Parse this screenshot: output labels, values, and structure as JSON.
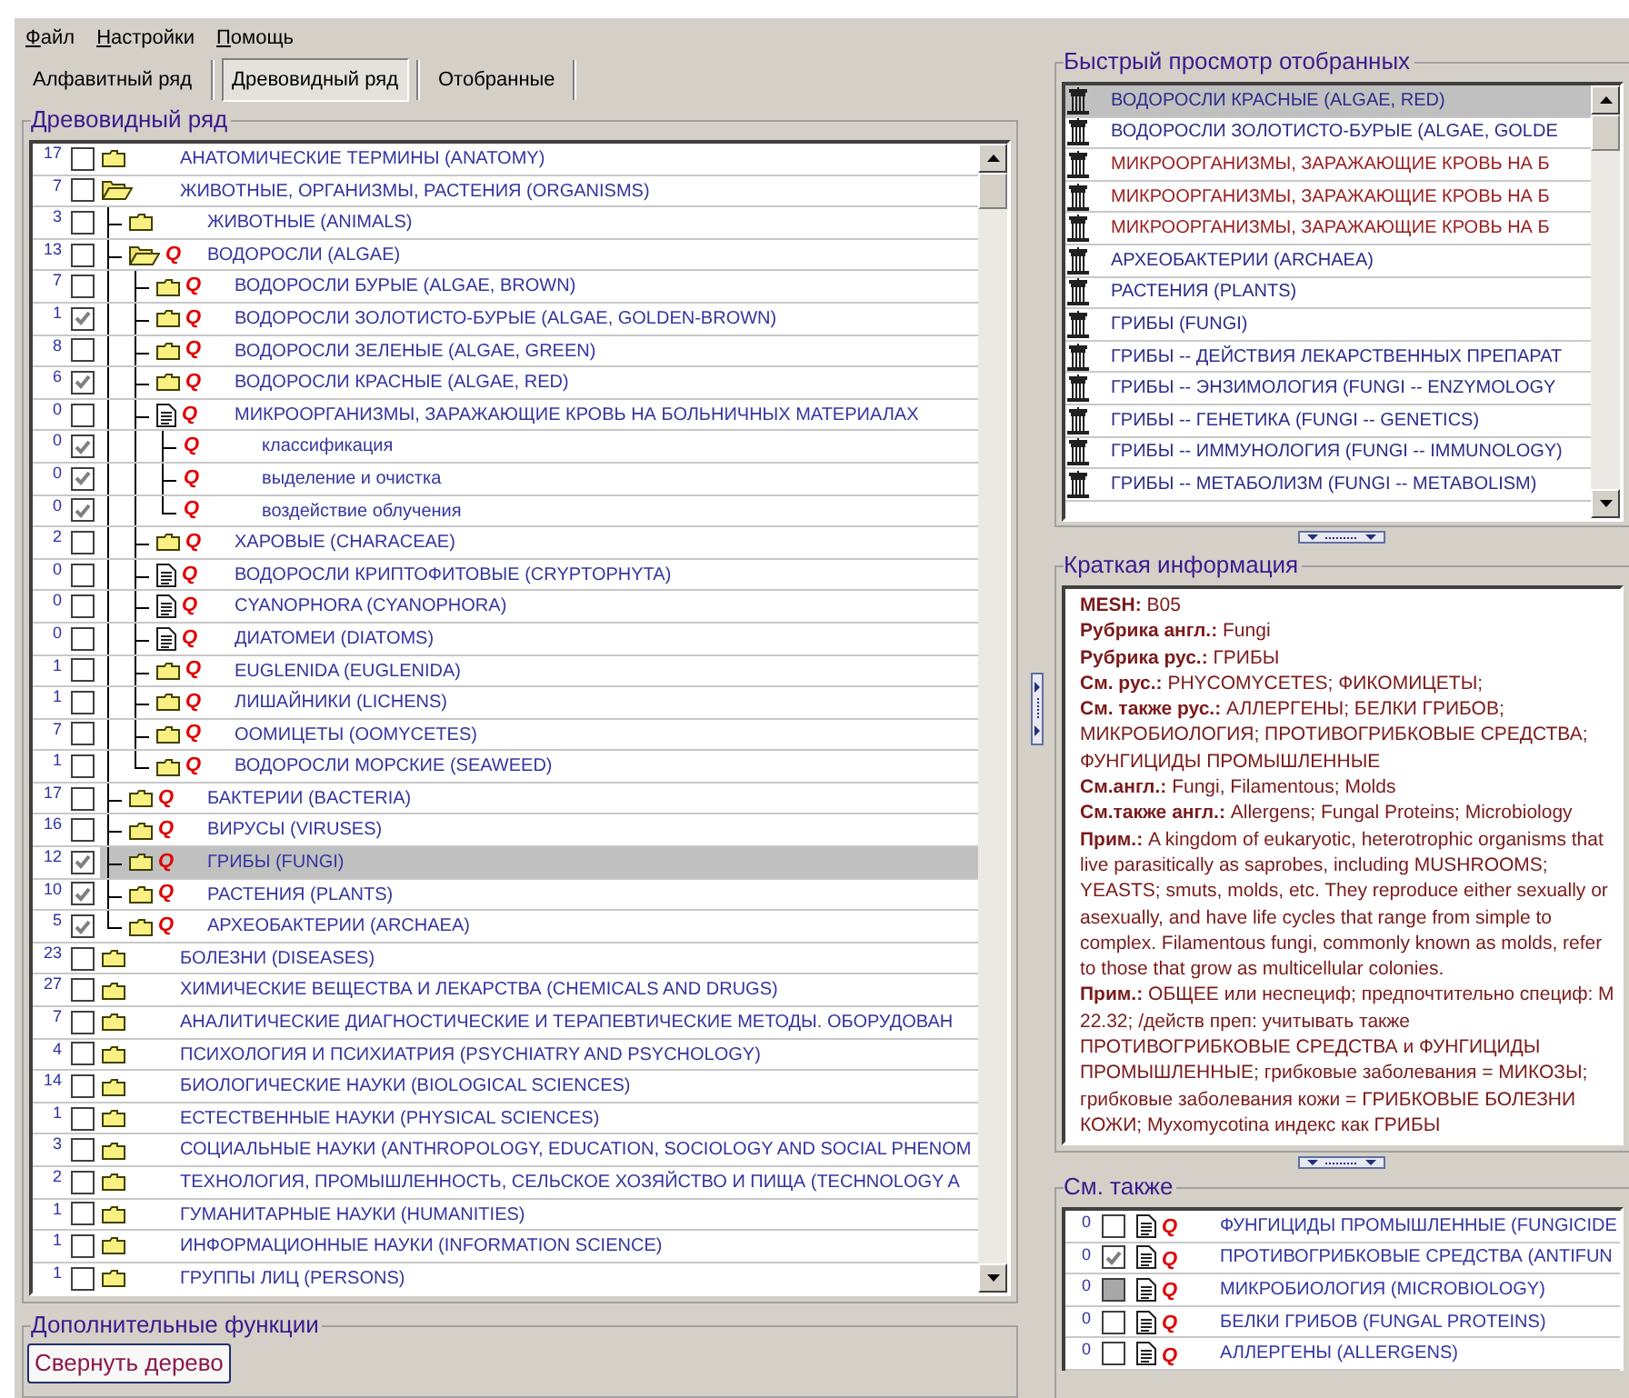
{
  "menu": [
    "Файл",
    "Настройки",
    "Помощь"
  ],
  "tabs": [
    {
      "label": "Алфавитный ряд",
      "selected": false
    },
    {
      "label": "Древовидный ряд",
      "selected": true
    },
    {
      "label": "Отобранные",
      "selected": false
    }
  ],
  "tree": {
    "title": "Древовидный ряд",
    "rows": [
      {
        "count": "17",
        "checked": false,
        "selected": false,
        "kind": "folder",
        "label": "АНАТОМИЧЕСКИЕ ТЕРМИНЫ (ANATOMY)"
      },
      {
        "count": "7",
        "checked": false,
        "selected": false,
        "kind": "open",
        "label": "ЖИВОТНЫЕ, ОРГАНИЗМЫ, РАСТЕНИЯ (ORGANISMS)",
        "children": [
          {
            "count": "3",
            "checked": false,
            "selected": false,
            "kind": "folder",
            "label": "ЖИВОТНЫЕ (ANIMALS)"
          },
          {
            "count": "13",
            "checked": false,
            "selected": false,
            "kind": "open",
            "mark": "Q",
            "label": "ВОДОРОСЛИ (ALGAE)",
            "children": [
              {
                "count": "7",
                "checked": false,
                "selected": false,
                "kind": "folder",
                "mark": "Q",
                "label": "ВОДОРОСЛИ БУРЫЕ (ALGAE, BROWN)"
              },
              {
                "count": "1",
                "checked": true,
                "selected": false,
                "kind": "folder",
                "mark": "Q",
                "label": "ВОДОРОСЛИ ЗОЛОТИСТО-БУРЫЕ (ALGAE, GOLDEN-BROWN)"
              },
              {
                "count": "8",
                "checked": false,
                "selected": false,
                "kind": "folder",
                "mark": "Q",
                "label": "ВОДОРОСЛИ ЗЕЛЕНЫЕ (ALGAE, GREEN)"
              },
              {
                "count": "6",
                "checked": true,
                "selected": false,
                "kind": "folder",
                "mark": "Q",
                "label": "ВОДОРОСЛИ КРАСНЫЕ (ALGAE, RED)"
              },
              {
                "count": "0",
                "checked": false,
                "selected": false,
                "kind": "document",
                "mark": "Q",
                "label": "МИКРООРГАНИЗМЫ, ЗАРАЖАЮЩИЕ КРОВЬ НА БОЛЬНИЧНЫХ МАТЕРИАЛАХ",
                "children": [
                  {
                    "count": "0",
                    "checked": true,
                    "selected": false,
                    "mark": "Q",
                    "label": "классификация"
                  },
                  {
                    "count": "0",
                    "checked": true,
                    "selected": false,
                    "mark": "Q",
                    "label": "выделение и очистка"
                  },
                  {
                    "count": "0",
                    "checked": true,
                    "selected": false,
                    "mark": "Q",
                    "label": "воздействие облучения"
                  }
                ]
              },
              {
                "count": "2",
                "checked": false,
                "selected": false,
                "kind": "folder",
                "mark": "Q",
                "label": "ХАРОВЫЕ (CHARACEAE)"
              },
              {
                "count": "0",
                "checked": false,
                "selected": false,
                "kind": "document",
                "mark": "Q",
                "label": "ВОДОРОСЛИ КРИПТОФИТОВЫЕ (CRYPTOPHYTA)"
              },
              {
                "count": "0",
                "checked": false,
                "selected": false,
                "kind": "document",
                "mark": "Q",
                "label": "CYANOPHORA (CYANOPHORA)"
              },
              {
                "count": "0",
                "checked": false,
                "selected": false,
                "kind": "document",
                "mark": "Q",
                "label": "ДИАТОМЕИ (DIATOMS)"
              },
              {
                "count": "1",
                "checked": false,
                "selected": false,
                "kind": "folder",
                "mark": "Q",
                "label": "EUGLENIDA (EUGLENIDA)"
              },
              {
                "count": "1",
                "checked": false,
                "selected": false,
                "kind": "folder",
                "mark": "Q",
                "label": "ЛИШАЙНИКИ (LICHENS)"
              },
              {
                "count": "7",
                "checked": false,
                "selected": false,
                "kind": "folder",
                "mark": "Q",
                "label": "ООМИЦЕТЫ (OOMYCETES)"
              },
              {
                "count": "1",
                "checked": false,
                "selected": false,
                "kind": "folder",
                "mark": "Q",
                "label": "ВОДОРОСЛИ МОРСКИЕ (SEAWEED)"
              }
            ]
          },
          {
            "count": "17",
            "checked": false,
            "selected": false,
            "kind": "folder",
            "mark": "Q",
            "label": "БАКТЕРИИ (BACTERIA)"
          },
          {
            "count": "16",
            "checked": false,
            "selected": false,
            "kind": "folder",
            "mark": "Q",
            "label": "ВИРУСЫ (VIRUSES)"
          },
          {
            "count": "12",
            "checked": true,
            "selected": true,
            "kind": "folder",
            "mark": "Q",
            "label": "ГРИБЫ (FUNGI)"
          },
          {
            "count": "10",
            "checked": true,
            "selected": false,
            "kind": "folder",
            "mark": "Q",
            "label": "РАСТЕНИЯ (PLANTS)"
          },
          {
            "count": "5",
            "checked": true,
            "selected": false,
            "kind": "folder",
            "mark": "Q",
            "label": "АРХЕОБАКТЕРИИ (ARCHAEA)"
          }
        ]
      },
      {
        "count": "23",
        "checked": false,
        "selected": false,
        "kind": "folder",
        "label": "БОЛЕЗНИ (DISEASES)"
      },
      {
        "count": "27",
        "checked": false,
        "selected": false,
        "kind": "folder",
        "label": "ХИМИЧЕСКИЕ ВЕЩЕСТВА И ЛЕКАРСТВА (CHEMICALS AND DRUGS)"
      },
      {
        "count": "7",
        "checked": false,
        "selected": false,
        "kind": "folder",
        "label": "АНАЛИТИЧЕСКИЕ ДИАГНОСТИЧЕСКИЕ И ТЕРАПЕВТИЧЕСКИЕ МЕТОДЫ. ОБОРУДОВАН"
      },
      {
        "count": "4",
        "checked": false,
        "selected": false,
        "kind": "folder",
        "label": "ПСИХОЛОГИЯ И ПСИХИАТРИЯ (PSYCHIATRY AND PSYCHOLOGY)"
      },
      {
        "count": "14",
        "checked": false,
        "selected": false,
        "kind": "folder",
        "label": "БИОЛОГИЧЕСКИЕ НАУКИ (BIOLOGICAL SCIENCES)"
      },
      {
        "count": "1",
        "checked": false,
        "selected": false,
        "kind": "folder",
        "label": "ЕСТЕСТВЕННЫЕ НАУКИ (PHYSICAL SCIENCES)"
      },
      {
        "count": "3",
        "checked": false,
        "selected": false,
        "kind": "folder",
        "label": "СОЦИАЛЬНЫЕ НАУКИ (ANTHROPOLOGY, EDUCATION, SOCIOLOGY AND SOCIAL PHENOM"
      },
      {
        "count": "2",
        "checked": false,
        "selected": false,
        "kind": "folder",
        "label": "ТЕХНОЛОГИЯ, ПРОМЫШЛЕННОСТЬ, СЕЛЬСКОЕ ХОЗЯЙСТВО И ПИЩА (TECHNOLOGY A"
      },
      {
        "count": "1",
        "checked": false,
        "selected": false,
        "kind": "folder",
        "label": "ГУМАНИТАРНЫЕ НАУКИ (HUMANITIES)"
      },
      {
        "count": "1",
        "checked": false,
        "selected": false,
        "kind": "folder",
        "label": "ИНФОРМАЦИОННЫЕ НАУКИ (INFORMATION SCIENCE)"
      },
      {
        "count": "1",
        "checked": false,
        "selected": false,
        "kind": "folder",
        "label": "ГРУППЫ ЛИЦ (PERSONS)"
      }
    ]
  },
  "extra": {
    "title": "Дополнительные функции",
    "button": "Свернуть дерево"
  },
  "quick_view": {
    "title": "Быстрый просмотр отобранных",
    "items": [
      {
        "label": "ВОДОРОСЛИ КРАСНЫЕ (ALGAE, RED)",
        "color": "#2c2c8c",
        "selected": true
      },
      {
        "label": "ВОДОРОСЛИ ЗОЛОТИСТО-БУРЫЕ (ALGAE, GOLDE",
        "color": "#2c2c8c",
        "selected": false
      },
      {
        "label": "МИКРООРГАНИЗМЫ, ЗАРАЖАЮЩИЕ КРОВЬ НА Б",
        "color": "#9a2020",
        "selected": false
      },
      {
        "label": "МИКРООРГАНИЗМЫ, ЗАРАЖАЮЩИЕ КРОВЬ НА Б",
        "color": "#9a2020",
        "selected": false
      },
      {
        "label": "МИКРООРГАНИЗМЫ, ЗАРАЖАЮЩИЕ КРОВЬ НА Б",
        "color": "#9a2020",
        "selected": false
      },
      {
        "label": "АРХЕОБАКТЕРИИ (ARCHAEA)",
        "color": "#2c2c8c",
        "selected": false
      },
      {
        "label": "РАСТЕНИЯ (PLANTS)",
        "color": "#2c2c8c",
        "selected": false
      },
      {
        "label": "ГРИБЫ (FUNGI)",
        "color": "#2c2c8c",
        "selected": false
      },
      {
        "label": "ГРИБЫ -- ДЕЙСТВИЯ ЛЕКАРСТВЕННЫХ ПРЕПАРАТ",
        "color": "#2c2c8c",
        "selected": false
      },
      {
        "label": "ГРИБЫ -- ЭНЗИМОЛОГИЯ (FUNGI -- ENZYMOLOGY",
        "color": "#2c2c8c",
        "selected": false
      },
      {
        "label": "ГРИБЫ -- ГЕНЕТИКА (FUNGI -- GENETICS)",
        "color": "#2c2c8c",
        "selected": false
      },
      {
        "label": "ГРИБЫ -- ИММУНОЛОГИЯ (FUNGI -- IMMUNOLOGY)",
        "color": "#2c2c8c",
        "selected": false
      },
      {
        "label": "ГРИБЫ -- МЕТАБОЛИЗМ (FUNGI -- METABOLISM)",
        "color": "#2c2c8c",
        "selected": false
      }
    ]
  },
  "info": {
    "title": "Краткая информация",
    "paragraphs": [
      "**MESH:** B05",
      "**Рубрика англ.:** Fungi",
      "**Рубрика рус.:** ГРИБЫ",
      "**См. рус.:** PHYCOMYCETES; ФИКОМИЦЕТЫ;",
      "**См. также рус.:** АЛЛЕРГЕНЫ; БЕЛКИ ГРИБОВ; МИКРОБИОЛОГИЯ; ПРОТИВОГРИБКОВЫЕ СРЕДСТВА; ФУНГИЦИДЫ ПРОМЫШЛЕННЫЕ",
      "**См.англ.:** Fungi, Filamentous; Molds",
      "**См.также англ.:** Allergens; Fungal Proteins; Microbiology",
      "**Прим.:** A kingdom of eukaryotic, heterotrophic organisms that live parasitically as saprobes, including MUSHROOMS; YEASTS; smuts, molds, etc. They reproduce either sexually or asexually, and have life cycles that range from simple to complex. Filamentous fungi, commonly known as molds, refer to those that grow as multicellular colonies.",
      "**Прим.:** ОБЩЕЕ или неспециф; предпочтительно специф: М 22.32; /действ преп: учитывать также ПРОТИВОГРИБКОВЫЕ СРЕДСТВА и ФУНГИЦИДЫ ПРОМЫШЛЕННЫЕ; грибковые заболевания = МИКОЗЫ; грибковые заболевания кожи = ГРИБКОВЫЕ БОЛЕЗНИ КОЖИ; Myxomycotina индекс как ГРИБЫ"
    ]
  },
  "see_also": {
    "title": "См. также",
    "rows": [
      {
        "count": "0",
        "checked": false,
        "mixed": false,
        "mark": "Q",
        "label": "ФУНГИЦИДЫ ПРОМЫШЛЕННЫЕ (FUNGICIDE"
      },
      {
        "count": "0",
        "checked": true,
        "mixed": false,
        "mark": "Q",
        "label": "ПРОТИВОГРИБКОВЫЕ СРЕДСТВА (ANTIFUN"
      },
      {
        "count": "0",
        "checked": false,
        "mixed": true,
        "mark": "Q",
        "label": "МИКРОБИОЛОГИЯ (MICROBIOLOGY)"
      },
      {
        "count": "0",
        "checked": false,
        "mixed": false,
        "mark": "Q",
        "label": "БЕЛКИ ГРИБОВ (FUNGAL PROTEINS)"
      },
      {
        "count": "0",
        "checked": false,
        "mixed": false,
        "mark": "Q",
        "label": "АЛЛЕРГЕНЫ (ALLERGENS)"
      }
    ]
  }
}
